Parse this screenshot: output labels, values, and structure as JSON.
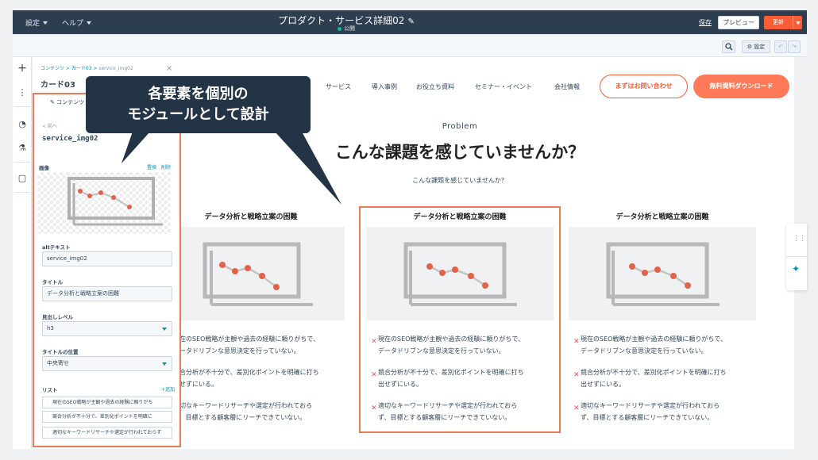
{
  "topbar": {
    "menu_settings": "設定",
    "menu_help": "ヘルプ",
    "page_title": "プロダクト・サービス詳細02",
    "pencil": "✎",
    "status": "公開",
    "save": "保存",
    "preview": "プレビュー",
    "update": "更新"
  },
  "toolrow": {
    "settings": "⚙ 設定"
  },
  "panel": {
    "breadcrumb": [
      "コンテンツ",
      "カード03",
      "service_img02"
    ],
    "close": "×",
    "title": "カード03",
    "tab_content": "コンテンツ",
    "back": "< 前へ",
    "module_name": "service_img02",
    "image_label": "画像",
    "image_replace": "置換",
    "image_delete": "削除",
    "alt_label": "altテキスト",
    "alt_value": "service_img02",
    "title_label": "タイトル",
    "title_value": "データ分析と戦略立案の困難",
    "heading_level_label": "見出しレベル",
    "heading_level_value": "h3",
    "title_position_label": "タイトルの位置",
    "title_position_value": "中央寄せ",
    "list_label": "リスト",
    "list_add": "+追加",
    "list_items": [
      "現在のSEO戦略が主観や過去の経験に頼りがち",
      "競合分析が不十分で、差別化ポイントを明確に",
      "適切なキーワードリサーチや選定が行われておらず"
    ]
  },
  "site": {
    "nav": [
      "サービス",
      "導入事例",
      "お役立ち資料",
      "セミナー・イベント",
      "会社情報"
    ],
    "cta_contact": "まずはお問い合わせ",
    "cta_download": "無料資料ダウンロード",
    "eyebrow": "Problem",
    "heading": "こんな課題を感じていませんか？",
    "subheading": "こんな課題を感じていませんか？",
    "cards": [
      {
        "title": "データ分析と戦略立案の困難",
        "items": [
          [
            "現在のSEO戦略が主観や過去の経験に頼りがちで、",
            "データドリブンな意思決定を行っていない。"
          ],
          [
            "競合分析が不十分で、差別化ポイントを明確に打ち",
            "出せずにいる。"
          ],
          [
            "適切なキーワードリサーチや選定が行われておら",
            "ず、目標とする顧客層にリーチできていない。"
          ]
        ]
      },
      {
        "title": "データ分析と戦略立案の困難",
        "items": [
          [
            "現在のSEO戦略が主観や過去の経験に頼りがちで、",
            "データドリブンな意思決定を行っていない。"
          ],
          [
            "競合分析が不十分で、差別化ポイントを明確に打ち",
            "出せずにいる。"
          ],
          [
            "適切なキーワードリサーチや選定が行われておら",
            "ず、目標とする顧客層にリーチできていない。"
          ]
        ]
      },
      {
        "title": "データ分析と戦略立案の困難",
        "items": [
          [
            "現在のSEO戦略が主観や過去の経験に頼りがちで、",
            "データドリブンな意思決定を行っていない。"
          ],
          [
            "競合分析が不十分で、差別化ポイントを明確に打ち",
            "出せずにいる。"
          ],
          [
            "適切なキーワードリサーチや選定が行われておら",
            "ず、目標とする顧客層にリーチできていない。"
          ]
        ]
      }
    ]
  },
  "callout": {
    "line1": "各要素を個別の",
    "line2": "モジュールとして設計"
  },
  "colors": {
    "accent": "#ff5c35",
    "highlight": "#ec7b55",
    "topbar": "#2d3e50",
    "callout": "#243447"
  }
}
